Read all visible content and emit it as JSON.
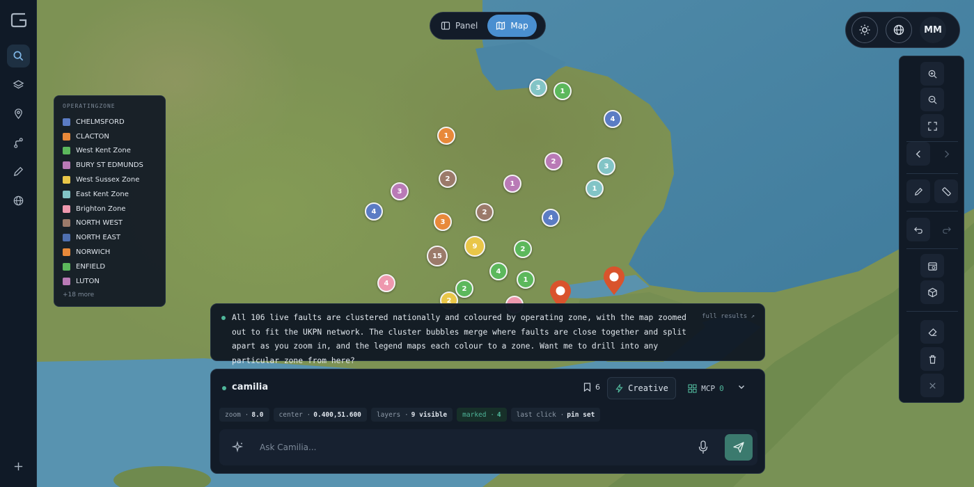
{
  "app": {
    "logo_icon": "g-logo-icon"
  },
  "sidebar": {
    "items": [
      {
        "icon": "search-icon",
        "active": true
      },
      {
        "icon": "layers-icon"
      },
      {
        "icon": "map-pin-icon"
      },
      {
        "icon": "route-icon"
      },
      {
        "icon": "pen-icon"
      },
      {
        "icon": "globe-icon"
      }
    ],
    "add_icon": "plus-icon"
  },
  "view_toggle": {
    "panel_label": "Panel",
    "map_label": "Map",
    "selected": "Map"
  },
  "top_right": {
    "theme_icon": "sun-icon",
    "globe_icon": "globe-icon",
    "avatar_initials": "MM"
  },
  "toolbar": {
    "tools": [
      "zoom-in-icon",
      "zoom-out-icon",
      "fullscreen-icon",
      "chevron-left-icon",
      "chevron-right-icon",
      "pencil-icon",
      "ruler-icon",
      "undo-icon",
      "redo-icon",
      "calendar-icon",
      "cube-icon",
      "eraser-icon",
      "trash-icon",
      "close-icon"
    ]
  },
  "legend": {
    "title": "OPERATINGZONE",
    "items": [
      {
        "label": "CHELMSFORD",
        "color": "#5b7cc4"
      },
      {
        "label": "CLACTON",
        "color": "#e8893a"
      },
      {
        "label": "West Kent Zone",
        "color": "#5cb85c"
      },
      {
        "label": "BURY ST EDMUNDS",
        "color": "#b97ab6"
      },
      {
        "label": "West Sussex Zone",
        "color": "#e9c648"
      },
      {
        "label": "East Kent Zone",
        "color": "#82c4c6"
      },
      {
        "label": "Brighton Zone",
        "color": "#ee98ae"
      },
      {
        "label": "NORTH WEST",
        "color": "#9b7a6a"
      },
      {
        "label": "NORTH EAST",
        "color": "#4e6fb0"
      },
      {
        "label": "NORWICH",
        "color": "#e8893a"
      },
      {
        "label": "ENFIELD",
        "color": "#5cb85c"
      },
      {
        "label": "LUTON",
        "color": "#b97ab6"
      }
    ],
    "more": "+18 more"
  },
  "clusters": [
    {
      "count": "3",
      "color": "#82c4c6"
    },
    {
      "count": "1",
      "color": "#5cb85c"
    },
    {
      "count": "4",
      "color": "#5b7cc4"
    },
    {
      "count": "1",
      "color": "#e8893a"
    },
    {
      "count": "2",
      "color": "#b97ab6"
    },
    {
      "count": "3",
      "color": "#82c4c6"
    },
    {
      "count": "2",
      "color": "#9b7a6a"
    },
    {
      "count": "1",
      "color": "#b97ab6"
    },
    {
      "count": "1",
      "color": "#82c4c6"
    },
    {
      "count": "3",
      "color": "#b97ab6"
    },
    {
      "count": "4",
      "color": "#5b7cc4"
    },
    {
      "count": "2",
      "color": "#9b7a6a"
    },
    {
      "count": "4",
      "color": "#5b7cc4"
    },
    {
      "count": "3",
      "color": "#e8893a"
    },
    {
      "count": "9",
      "color": "#e9c648"
    },
    {
      "count": "2",
      "color": "#5cb85c"
    },
    {
      "count": "15",
      "color": "#9b7a6a"
    },
    {
      "count": "4",
      "color": "#5cb85c"
    },
    {
      "count": "1",
      "color": "#5cb85c"
    },
    {
      "count": "4",
      "color": "#ee98ae"
    },
    {
      "count": "2",
      "color": "#5cb85c"
    },
    {
      "count": "2",
      "color": "#e9c648"
    },
    {
      "count": "",
      "color": "#ee98ae"
    }
  ],
  "pins": [
    {
      "icon": "map-pin-icon",
      "color": "#d9532c"
    },
    {
      "icon": "map-pin-icon",
      "color": "#d9532c"
    }
  ],
  "message": {
    "text": "All 106 live faults are clustered nationally and coloured by operating zone, with the map zoomed out to fit the UKPN network. The cluster bubbles merge where faults are close together and split apart as you zoom in, and the legend maps each colour to a zone. Want me to drill into any particular zone from here?",
    "link": "full results ↗"
  },
  "composer": {
    "agent_name": "camilia",
    "bookmark_count": "6",
    "mode_label": "Creative",
    "mcp_label": "MCP",
    "mcp_count": "0",
    "chips": [
      {
        "key": "zoom ·",
        "value": "8.0"
      },
      {
        "key": "center ·",
        "value": "0.400,51.600"
      },
      {
        "key": "layers ·",
        "value": "9 visible"
      },
      {
        "key": "marked ·",
        "value": "4",
        "highlight": true
      },
      {
        "key": "last click ·",
        "value": "pin set"
      }
    ],
    "input_placeholder": "Ask Camilia..."
  }
}
